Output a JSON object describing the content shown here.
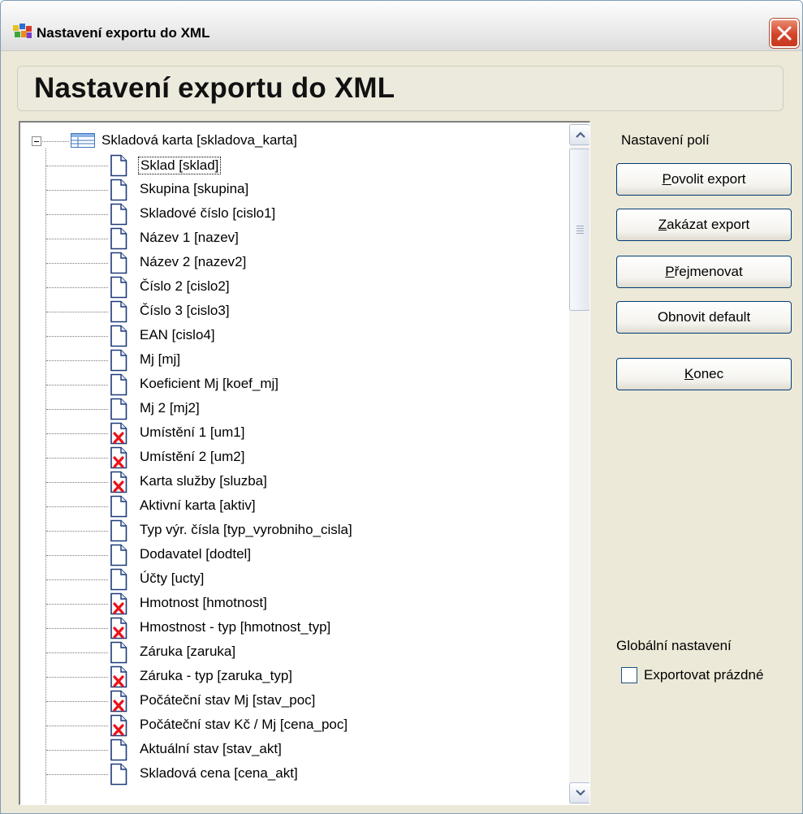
{
  "window": {
    "title": "Nastavení exportu do XML",
    "close_icon": "close-x-icon"
  },
  "header": {
    "title": "Nastavení exportu do XML"
  },
  "tree": {
    "root": {
      "label": "Skladová karta [skladova_karta]",
      "expanded": true,
      "icon": "record-table-icon"
    },
    "items": [
      {
        "label": "Sklad [sklad]",
        "export": true,
        "selected": true
      },
      {
        "label": "Skupina [skupina]",
        "export": true
      },
      {
        "label": "Skladové číslo [cislo1]",
        "export": true
      },
      {
        "label": "Název 1 [nazev]",
        "export": true
      },
      {
        "label": "Název 2 [nazev2]",
        "export": true
      },
      {
        "label": "Číslo 2 [cislo2]",
        "export": true
      },
      {
        "label": "Číslo 3 [cislo3]",
        "export": true
      },
      {
        "label": "EAN [cislo4]",
        "export": true
      },
      {
        "label": "Mj [mj]",
        "export": true
      },
      {
        "label": "Koeficient Mj [koef_mj]",
        "export": true
      },
      {
        "label": "Mj 2 [mj2]",
        "export": true
      },
      {
        "label": "Umístění 1 [um1]",
        "export": false
      },
      {
        "label": "Umístění 2 [um2]",
        "export": false
      },
      {
        "label": "Karta služby [sluzba]",
        "export": false
      },
      {
        "label": "Aktivní karta [aktiv]",
        "export": true
      },
      {
        "label": "Typ výr. čísla [typ_vyrobniho_cisla]",
        "export": true
      },
      {
        "label": "Dodavatel [dodtel]",
        "export": true
      },
      {
        "label": "Účty [ucty]",
        "export": true
      },
      {
        "label": "Hmotnost [hmotnost]",
        "export": false
      },
      {
        "label": "Hmostnost - typ [hmotnost_typ]",
        "export": false
      },
      {
        "label": "Záruka [zaruka]",
        "export": true
      },
      {
        "label": "Záruka - typ [zaruka_typ]",
        "export": false
      },
      {
        "label": "Počáteční stav Mj [stav_poc]",
        "export": false
      },
      {
        "label": "Počáteční stav Kč / Mj [cena_poc]",
        "export": false
      },
      {
        "label": "Aktuální stav [stav_akt]",
        "export": true
      },
      {
        "label": "Skladová cena [cena_akt]",
        "export": true
      }
    ]
  },
  "side": {
    "fields_label": "Nastavení polí",
    "buttons": {
      "enable": {
        "pre": "",
        "key": "P",
        "post": "ovolit export"
      },
      "disable": {
        "pre": "",
        "key": "Z",
        "post": "akázat export"
      },
      "rename": {
        "pre": "",
        "key": "P",
        "post": "řejmenovat"
      },
      "reset": {
        "pre": "Obnovit default",
        "key": "",
        "post": ""
      },
      "close": {
        "pre": "",
        "key": "K",
        "post": "onec"
      }
    },
    "global_label": "Globální nastavení",
    "export_empty_label": "Exportovat prázdné",
    "export_empty_checked": false
  }
}
